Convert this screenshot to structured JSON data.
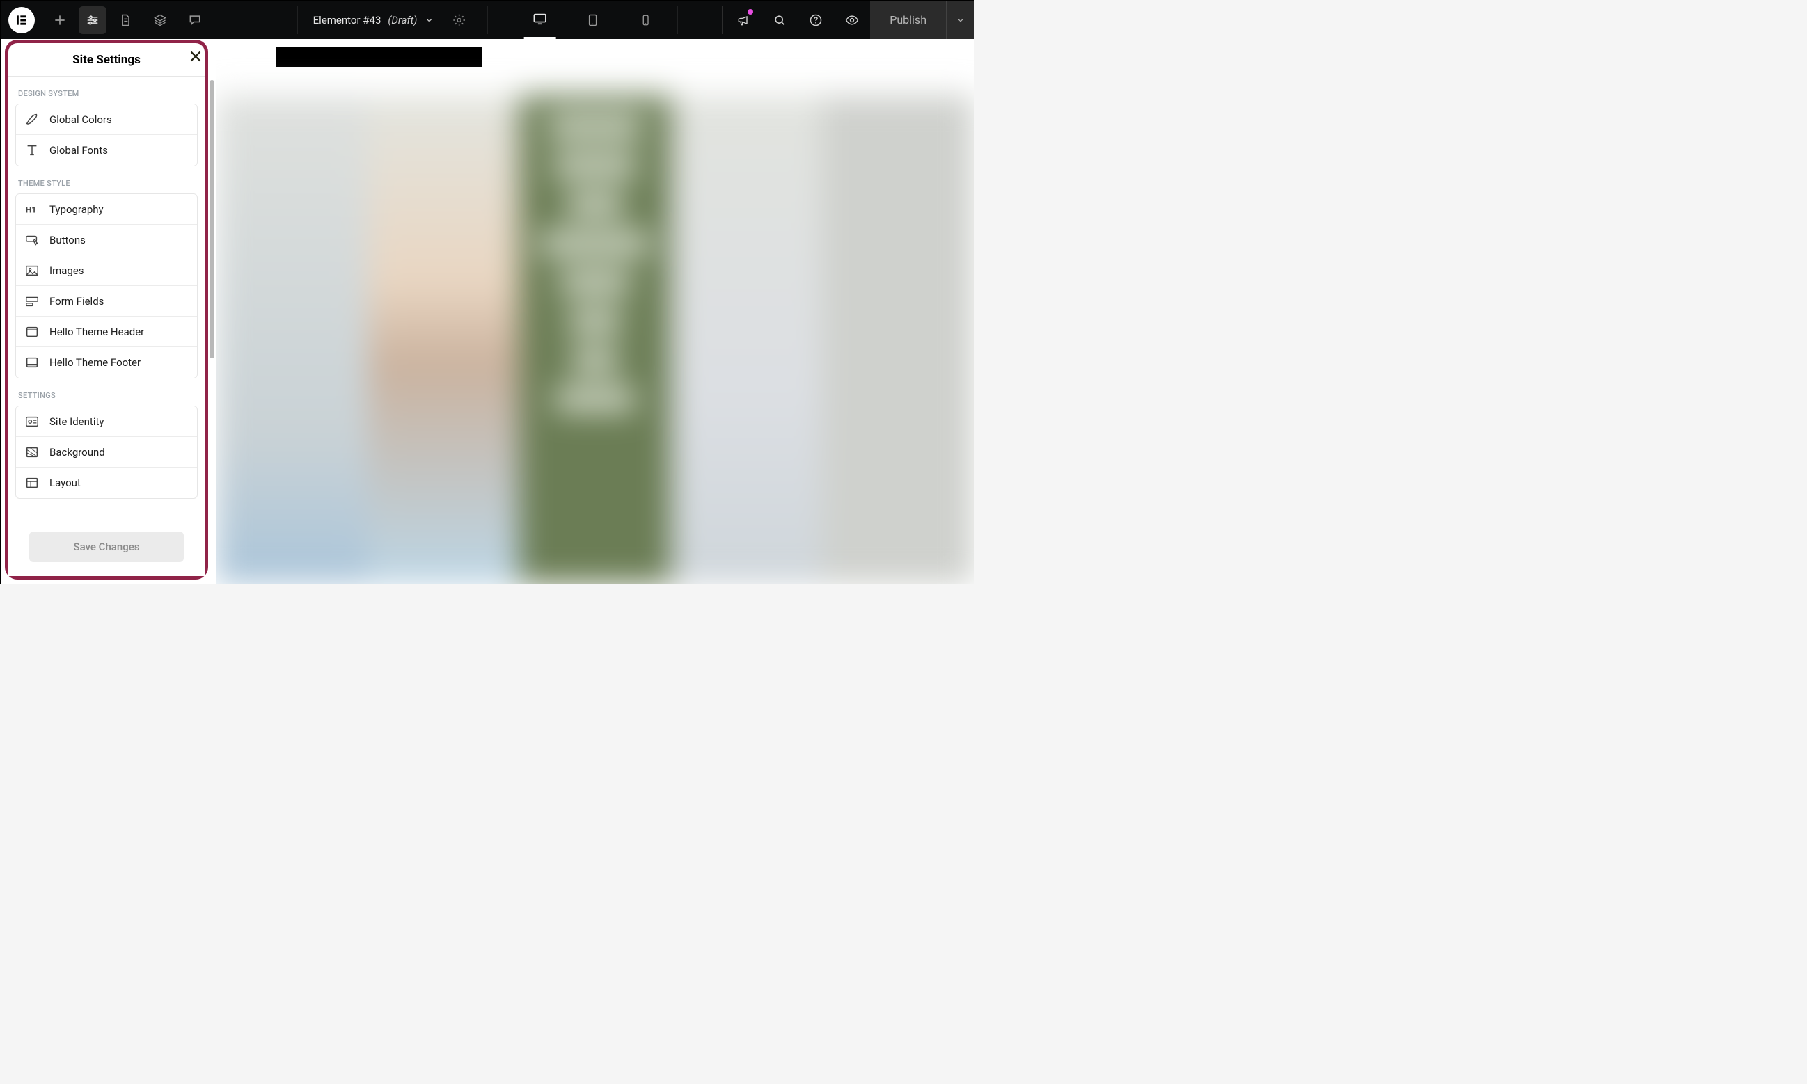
{
  "topbar": {
    "doc_title": "Elementor #43",
    "doc_state": "(Draft)",
    "publish_label": "Publish"
  },
  "panel": {
    "title": "Site Settings",
    "sections": {
      "design_system": {
        "label": "DESIGN SYSTEM",
        "items": {
          "colors": "Global Colors",
          "fonts": "Global Fonts"
        }
      },
      "theme_style": {
        "label": "THEME STYLE",
        "items": {
          "typography": "Typography",
          "buttons": "Buttons",
          "images": "Images",
          "form_fields": "Form Fields",
          "header": "Hello Theme Header",
          "footer": "Hello Theme Footer"
        }
      },
      "settings": {
        "label": "SETTINGS",
        "items": {
          "identity": "Site Identity",
          "background": "Background",
          "layout": "Layout"
        }
      }
    },
    "save_label": "Save Changes"
  }
}
